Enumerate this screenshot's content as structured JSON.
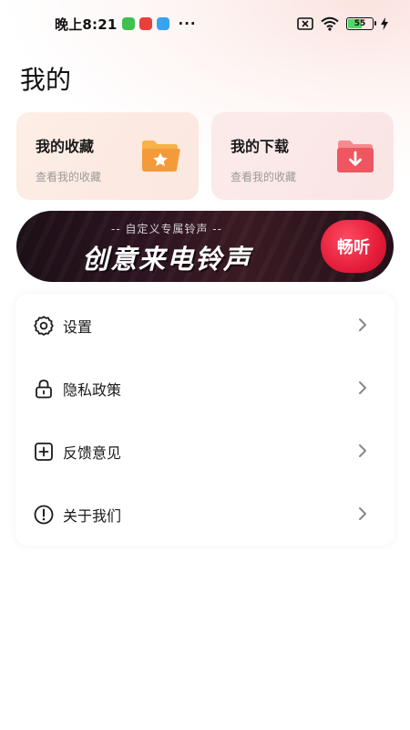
{
  "status_bar": {
    "time": "晚上8:21",
    "more": "···",
    "battery": "55"
  },
  "page": {
    "title": "我的"
  },
  "cards": [
    {
      "title": "我的收藏",
      "subtitle": "查看我的收藏",
      "icon": "star-folder-icon"
    },
    {
      "title": "我的下载",
      "subtitle": "查看我的收藏",
      "icon": "download-folder-icon"
    }
  ],
  "banner": {
    "subtitle": "-- 自定义专属铃声 --",
    "title": "创意来电铃声",
    "button": "畅听"
  },
  "menu": [
    {
      "label": "设置",
      "icon": "gear-icon"
    },
    {
      "label": "隐私政策",
      "icon": "lock-icon"
    },
    {
      "label": "反馈意见",
      "icon": "plus-box-icon"
    },
    {
      "label": "关于我们",
      "icon": "info-icon"
    }
  ],
  "colors": {
    "accent": "#e51d3a",
    "folder_orange": "#f5a640",
    "folder_red": "#ef5a64"
  }
}
